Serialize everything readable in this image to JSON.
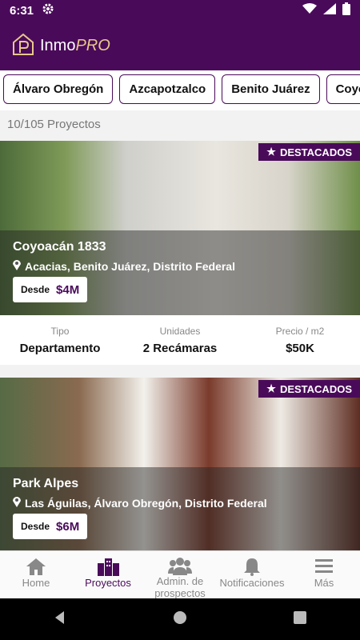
{
  "status": {
    "time": "6:31"
  },
  "app": {
    "logo_main": "Inmo",
    "logo_accent": "PRO"
  },
  "chips": [
    "Álvaro Obregón",
    "Azcapotzalco",
    "Benito Juárez",
    "Coyoacán"
  ],
  "count": "10/105 Proyectos",
  "cards": [
    {
      "badge": "DESTACADOS",
      "title": "Coyoacán 1833",
      "location": "Acacias, Benito Juárez, Distrito Federal",
      "from_label": "Desde",
      "price": "$4M",
      "stats": [
        {
          "label": "Tipo",
          "value": "Departamento"
        },
        {
          "label": "Unidades",
          "value": "2 Recámaras"
        },
        {
          "label": "Precio / m2",
          "value": "$50K"
        }
      ]
    },
    {
      "badge": "DESTACADOS",
      "title": "Park Alpes",
      "location": "Las Águilas, Álvaro Obregón, Distrito Federal",
      "from_label": "Desde",
      "price": "$6M"
    }
  ],
  "nav": [
    {
      "label": "Home",
      "icon": "home-icon"
    },
    {
      "label": "Proyectos",
      "icon": "buildings-icon",
      "active": true
    },
    {
      "label": "Admin. de prospectos",
      "icon": "users-icon"
    },
    {
      "label": "Notificaciones",
      "icon": "bell-icon"
    },
    {
      "label": "Más",
      "icon": "menu-icon"
    }
  ],
  "colors": {
    "primary": "#4a0a5a",
    "accent": "#e8c88a"
  }
}
